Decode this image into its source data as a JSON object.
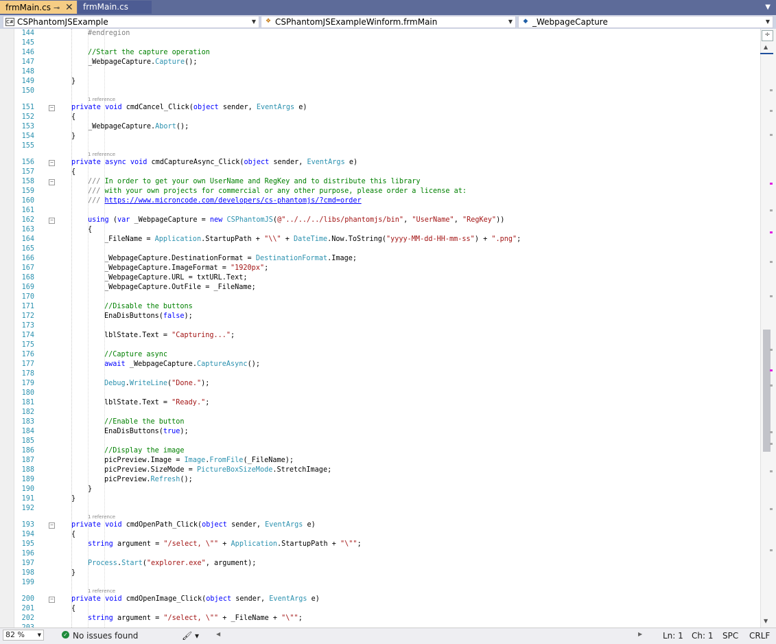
{
  "tabs": [
    {
      "label": "frmMain.cs",
      "active": true
    },
    {
      "label": "frmMain.cs",
      "active": false
    }
  ],
  "nav": {
    "project": "CSPhantomJSExample",
    "class": "CSPhantomJSExampleWinform.frmMain",
    "member": "_WebpageCapture"
  },
  "code_lens": "1 reference",
  "lines": [
    {
      "n": "144",
      "indent": 2,
      "t": [
        [
          "gr",
          "#endregion"
        ]
      ]
    },
    {
      "n": "145",
      "indent": 0,
      "t": []
    },
    {
      "n": "146",
      "indent": 2,
      "t": [
        [
          "cm",
          "//Start the capture operation"
        ]
      ]
    },
    {
      "n": "147",
      "indent": 2,
      "t": [
        [
          "df",
          "_WebpageCapture."
        ],
        [
          "ty",
          "Capture"
        ],
        [
          "df",
          "();"
        ]
      ]
    },
    {
      "n": "148",
      "indent": 0,
      "t": []
    },
    {
      "n": "149",
      "indent": 1,
      "t": [
        [
          "df",
          "}"
        ]
      ]
    },
    {
      "n": "150",
      "indent": 0,
      "t": []
    },
    {
      "n": "151",
      "indent": 1,
      "fold": true,
      "t": [
        [
          "kw",
          "private void "
        ],
        [
          "df",
          "cmdCancel_Click("
        ],
        [
          "kw",
          "object "
        ],
        [
          "df",
          "sender, "
        ],
        [
          "ty",
          "EventArgs "
        ],
        [
          "df",
          "e)"
        ]
      ]
    },
    {
      "n": "152",
      "indent": 1,
      "t": [
        [
          "df",
          "{"
        ]
      ]
    },
    {
      "n": "153",
      "indent": 2,
      "t": [
        [
          "df",
          "_WebpageCapture."
        ],
        [
          "ty",
          "Abort"
        ],
        [
          "df",
          "();"
        ]
      ]
    },
    {
      "n": "154",
      "indent": 1,
      "t": [
        [
          "df",
          "}"
        ]
      ]
    },
    {
      "n": "155",
      "indent": 0,
      "t": []
    },
    {
      "n": "156",
      "indent": 1,
      "fold": true,
      "t": [
        [
          "kw",
          "private async void "
        ],
        [
          "df",
          "cmdCaptureAsync_Click("
        ],
        [
          "kw",
          "object "
        ],
        [
          "df",
          "sender, "
        ],
        [
          "ty",
          "EventArgs "
        ],
        [
          "df",
          "e)"
        ]
      ]
    },
    {
      "n": "157",
      "indent": 1,
      "t": [
        [
          "df",
          "{"
        ]
      ]
    },
    {
      "n": "158",
      "indent": 2,
      "fold": true,
      "t": [
        [
          "gr",
          "/// "
        ],
        [
          "cm",
          "In order to get your own UserName and RegKey and to distribute this library"
        ]
      ]
    },
    {
      "n": "159",
      "indent": 2,
      "t": [
        [
          "gr",
          "/// "
        ],
        [
          "cm",
          "with your own projects for commercial or any other purpose, please order a license at:"
        ]
      ]
    },
    {
      "n": "160",
      "indent": 2,
      "t": [
        [
          "gr",
          "/// "
        ],
        [
          "lk",
          "https://www.microncode.com/developers/cs-phantomjs/?cmd=order"
        ]
      ]
    },
    {
      "n": "161",
      "indent": 0,
      "t": []
    },
    {
      "n": "162",
      "indent": 2,
      "fold": true,
      "t": [
        [
          "kw",
          "using "
        ],
        [
          "df",
          "("
        ],
        [
          "kw",
          "var "
        ],
        [
          "df",
          "_WebpageCapture = "
        ],
        [
          "kw",
          "new "
        ],
        [
          "ty",
          "CSPhantomJS"
        ],
        [
          "df",
          "("
        ],
        [
          "st",
          "@\"../../../libs/phantomjs/bin\""
        ],
        [
          "df",
          ", "
        ],
        [
          "st",
          "\"UserName\""
        ],
        [
          "df",
          ", "
        ],
        [
          "st",
          "\"RegKey\""
        ],
        [
          "df",
          "))"
        ]
      ]
    },
    {
      "n": "163",
      "indent": 2,
      "t": [
        [
          "df",
          "{"
        ]
      ]
    },
    {
      "n": "164",
      "indent": 3,
      "t": [
        [
          "df",
          "_FileName = "
        ],
        [
          "ty",
          "Application"
        ],
        [
          "df",
          ".StartupPath + "
        ],
        [
          "st",
          "\"\\\\\""
        ],
        [
          "df",
          " + "
        ],
        [
          "ty",
          "DateTime"
        ],
        [
          "df",
          ".Now.ToString("
        ],
        [
          "st",
          "\"yyyy-MM-dd-HH-mm-ss\""
        ],
        [
          "df",
          ") + "
        ],
        [
          "st",
          "\".png\""
        ],
        [
          "df",
          ";"
        ]
      ]
    },
    {
      "n": "165",
      "indent": 0,
      "t": []
    },
    {
      "n": "166",
      "indent": 3,
      "t": [
        [
          "df",
          "_WebpageCapture.DestinationFormat = "
        ],
        [
          "ty",
          "DestinationFormat"
        ],
        [
          "df",
          ".Image;"
        ]
      ]
    },
    {
      "n": "167",
      "indent": 3,
      "t": [
        [
          "df",
          "_WebpageCapture.ImageFormat = "
        ],
        [
          "st",
          "\"1920px\""
        ],
        [
          "df",
          ";"
        ]
      ]
    },
    {
      "n": "168",
      "indent": 3,
      "t": [
        [
          "df",
          "_WebpageCapture.URL = txtURL.Text;"
        ]
      ]
    },
    {
      "n": "169",
      "indent": 3,
      "t": [
        [
          "df",
          "_WebpageCapture.OutFile = _FileName;"
        ]
      ]
    },
    {
      "n": "170",
      "indent": 0,
      "t": []
    },
    {
      "n": "171",
      "indent": 3,
      "t": [
        [
          "cm",
          "//Disable the buttons"
        ]
      ]
    },
    {
      "n": "172",
      "indent": 3,
      "t": [
        [
          "df",
          "EnaDisButtons("
        ],
        [
          "kw",
          "false"
        ],
        [
          "df",
          ");"
        ]
      ]
    },
    {
      "n": "173",
      "indent": 0,
      "t": []
    },
    {
      "n": "174",
      "indent": 3,
      "t": [
        [
          "df",
          "lblState.Text = "
        ],
        [
          "st",
          "\"Capturing...\""
        ],
        [
          "df",
          ";"
        ]
      ]
    },
    {
      "n": "175",
      "indent": 0,
      "t": []
    },
    {
      "n": "176",
      "indent": 3,
      "t": [
        [
          "cm",
          "//Capture async"
        ]
      ]
    },
    {
      "n": "177",
      "indent": 3,
      "t": [
        [
          "kw",
          "await "
        ],
        [
          "df",
          "_WebpageCapture."
        ],
        [
          "ty",
          "CaptureAsync"
        ],
        [
          "df",
          "();"
        ]
      ]
    },
    {
      "n": "178",
      "indent": 0,
      "t": []
    },
    {
      "n": "179",
      "indent": 3,
      "t": [
        [
          "ty",
          "Debug"
        ],
        [
          "df",
          "."
        ],
        [
          "ty",
          "WriteLine"
        ],
        [
          "df",
          "("
        ],
        [
          "st",
          "\"Done.\""
        ],
        [
          "df",
          ");"
        ]
      ]
    },
    {
      "n": "180",
      "indent": 0,
      "t": []
    },
    {
      "n": "181",
      "indent": 3,
      "t": [
        [
          "df",
          "lblState.Text = "
        ],
        [
          "st",
          "\"Ready.\""
        ],
        [
          "df",
          ";"
        ]
      ]
    },
    {
      "n": "182",
      "indent": 0,
      "t": []
    },
    {
      "n": "183",
      "indent": 3,
      "t": [
        [
          "cm",
          "//Enable the button"
        ]
      ]
    },
    {
      "n": "184",
      "indent": 3,
      "t": [
        [
          "df",
          "EnaDisButtons("
        ],
        [
          "kw",
          "true"
        ],
        [
          "df",
          ");"
        ]
      ]
    },
    {
      "n": "185",
      "indent": 0,
      "t": []
    },
    {
      "n": "186",
      "indent": 3,
      "t": [
        [
          "cm",
          "//Display the image"
        ]
      ]
    },
    {
      "n": "187",
      "indent": 3,
      "t": [
        [
          "df",
          "picPreview.Image = "
        ],
        [
          "ty",
          "Image"
        ],
        [
          "df",
          "."
        ],
        [
          "ty",
          "FromFile"
        ],
        [
          "df",
          "(_FileName);"
        ]
      ]
    },
    {
      "n": "188",
      "indent": 3,
      "t": [
        [
          "df",
          "picPreview.SizeMode = "
        ],
        [
          "ty",
          "PictureBoxSizeMode"
        ],
        [
          "df",
          ".StretchImage;"
        ]
      ]
    },
    {
      "n": "189",
      "indent": 3,
      "t": [
        [
          "df",
          "picPreview."
        ],
        [
          "ty",
          "Refresh"
        ],
        [
          "df",
          "();"
        ]
      ]
    },
    {
      "n": "190",
      "indent": 2,
      "t": [
        [
          "df",
          "}"
        ]
      ]
    },
    {
      "n": "191",
      "indent": 1,
      "t": [
        [
          "df",
          "}"
        ]
      ]
    },
    {
      "n": "192",
      "indent": 0,
      "t": []
    },
    {
      "n": "193",
      "indent": 1,
      "fold": true,
      "t": [
        [
          "kw",
          "private void "
        ],
        [
          "df",
          "cmdOpenPath_Click("
        ],
        [
          "kw",
          "object "
        ],
        [
          "df",
          "sender, "
        ],
        [
          "ty",
          "EventArgs "
        ],
        [
          "df",
          "e)"
        ]
      ]
    },
    {
      "n": "194",
      "indent": 1,
      "t": [
        [
          "df",
          "{"
        ]
      ]
    },
    {
      "n": "195",
      "indent": 2,
      "t": [
        [
          "kw",
          "string "
        ],
        [
          "df",
          "argument = "
        ],
        [
          "st",
          "\"/select, \\\"\""
        ],
        [
          "df",
          " + "
        ],
        [
          "ty",
          "Application"
        ],
        [
          "df",
          ".StartupPath + "
        ],
        [
          "st",
          "\"\\\"\""
        ],
        [
          "df",
          ";"
        ]
      ]
    },
    {
      "n": "196",
      "indent": 0,
      "t": []
    },
    {
      "n": "197",
      "indent": 2,
      "t": [
        [
          "ty",
          "Process"
        ],
        [
          "df",
          "."
        ],
        [
          "ty",
          "Start"
        ],
        [
          "df",
          "("
        ],
        [
          "st",
          "\"explorer.exe\""
        ],
        [
          "df",
          ", argument);"
        ]
      ]
    },
    {
      "n": "198",
      "indent": 1,
      "t": [
        [
          "df",
          "}"
        ]
      ]
    },
    {
      "n": "199",
      "indent": 0,
      "t": []
    },
    {
      "n": "200",
      "indent": 1,
      "fold": true,
      "t": [
        [
          "kw",
          "private void "
        ],
        [
          "df",
          "cmdOpenImage_Click("
        ],
        [
          "kw",
          "object "
        ],
        [
          "df",
          "sender, "
        ],
        [
          "ty",
          "EventArgs "
        ],
        [
          "df",
          "e)"
        ]
      ]
    },
    {
      "n": "201",
      "indent": 1,
      "t": [
        [
          "df",
          "{"
        ]
      ]
    },
    {
      "n": "202",
      "indent": 2,
      "t": [
        [
          "kw",
          "string "
        ],
        [
          "df",
          "argument = "
        ],
        [
          "st",
          "\"/select, \\\"\""
        ],
        [
          "df",
          " + _FileName + "
        ],
        [
          "st",
          "\"\\\"\""
        ],
        [
          "df",
          ";"
        ]
      ]
    },
    {
      "n": "203",
      "indent": 0,
      "t": []
    }
  ],
  "status": {
    "zoom": "82 %",
    "issues": "No issues found",
    "line": "Ln: 1",
    "col": "Ch: 1",
    "whitespace": "SPC",
    "eol": "CRLF"
  },
  "colors": {
    "keyword": "#0000ff",
    "type": "#2b91af",
    "string": "#a31515",
    "comment": "#008000",
    "tab_active": "#f5cc84",
    "tab_bar": "#5d6b99"
  }
}
